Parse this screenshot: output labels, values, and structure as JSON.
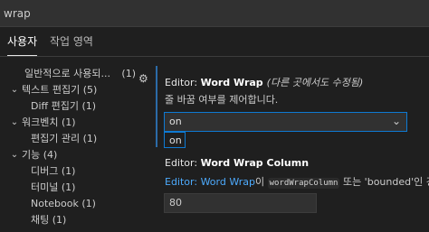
{
  "search": {
    "value": "wrap"
  },
  "tabs": [
    {
      "label": "사용자"
    },
    {
      "label": "작업 영역"
    }
  ],
  "toc": [
    {
      "label": "일반적으로 사용되...",
      "count": "(1)"
    },
    {
      "label": "텍스트 편집기 (5)"
    },
    {
      "label": "Diff 편집기 (1)"
    },
    {
      "label": "워크벤치 (1)"
    },
    {
      "label": "편집기 관리 (1)"
    },
    {
      "label": "기능 (4)"
    },
    {
      "label": "디버그 (1)"
    },
    {
      "label": "터미널 (1)"
    },
    {
      "label": "Notebook (1)"
    },
    {
      "label": "채팅 (1)"
    }
  ],
  "word_wrap": {
    "category": "Editor: ",
    "name": "Word Wrap",
    "modified": "(다른 곳에서도 수정됨)",
    "description": "줄 바꿈 여부를 제어합니다.",
    "value": "on",
    "options": [
      "on"
    ]
  },
  "word_wrap_column": {
    "category": "Editor: ",
    "name": "Word Wrap Column",
    "desc_link": "Editor: Word Wrap",
    "desc_text1": "이 ",
    "desc_code": "wordWrapColumn",
    "desc_text2": " 또는 'bounded'인 경우",
    "value": "80"
  }
}
